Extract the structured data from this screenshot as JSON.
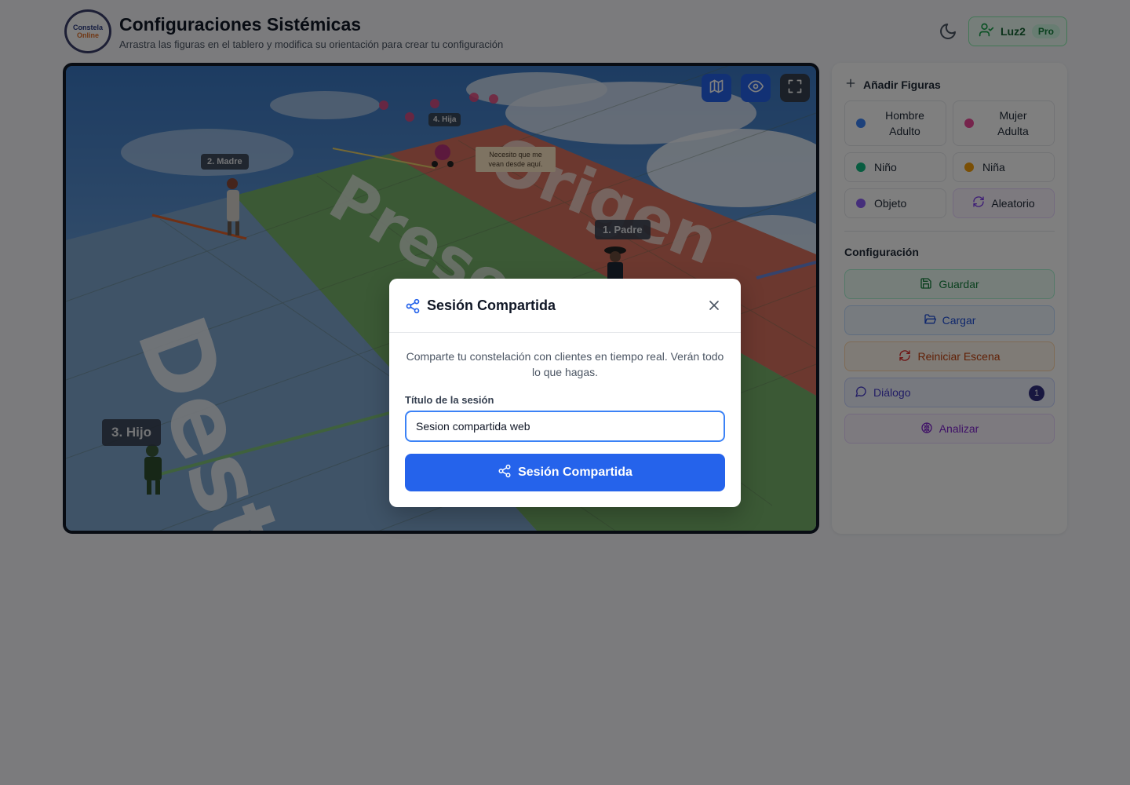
{
  "header": {
    "logo_line1": "Constela",
    "logo_line2": "Online",
    "title": "Configuraciones Sistémicas",
    "subtitle": "Arrastra las figuras en el tablero y modifica su orientación para crear tu configuración",
    "theme_icon": "moon-icon",
    "user": {
      "name": "Luz2",
      "plan": "Pro",
      "icon": "user-check-icon"
    }
  },
  "scene": {
    "tools": [
      {
        "name": "map-view",
        "icon": "map-icon"
      },
      {
        "name": "visibility",
        "icon": "eye-icon"
      },
      {
        "name": "fullscreen",
        "icon": "expand-icon"
      }
    ],
    "board_words": {
      "destino": "Destino",
      "presente": "Presente",
      "origen": "Origen"
    },
    "figures": {
      "madre": "2. Madre",
      "hija": "4. Hija",
      "padre": "1. Padre",
      "hijo": "3. Hijo"
    },
    "speech": "Necesito que me vean desde aquí."
  },
  "panel": {
    "add_title": "Añadir Figuras",
    "figures": [
      {
        "label": "Hombre Adulto",
        "color": "#3b82f6"
      },
      {
        "label": "Mujer Adulta",
        "color": "#ec4899"
      },
      {
        "label": "Niño",
        "color": "#10b981"
      },
      {
        "label": "Niña",
        "color": "#f59e0b"
      },
      {
        "label": "Objeto",
        "color": "#8b5cf6"
      },
      {
        "label": "Aleatorio",
        "icon": "refresh-icon"
      }
    ],
    "config_title": "Configuración",
    "actions": {
      "save": "Guardar",
      "load": "Cargar",
      "reset": "Reiniciar Escena",
      "dialog": "Diálogo",
      "dialog_count": "1",
      "analyze": "Analizar"
    }
  },
  "modal": {
    "title": "Sesión Compartida",
    "description": "Comparte tu constelación con clientes en tiempo real. Verán todo lo que hagas.",
    "field_label": "Título de la sesión",
    "field_value": "Sesion compartida web",
    "submit": "Sesión Compartida"
  }
}
